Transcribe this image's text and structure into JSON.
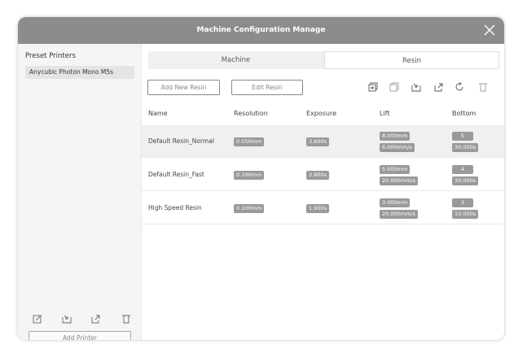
{
  "window": {
    "title": "Machine Configuration Manage"
  },
  "sidebar": {
    "title": "Preset Printers",
    "items": [
      {
        "label": "Anycubic Photon Mono M5s"
      }
    ],
    "icons": [
      "edit-icon",
      "import-icon",
      "export-icon",
      "delete-icon"
    ],
    "add_printer": "Add Printer"
  },
  "tabs": [
    {
      "label": "Machine",
      "active": false
    },
    {
      "label": "Resin",
      "active": true
    }
  ],
  "toolbar": {
    "add_new_resin": "Add New Resin",
    "edit_resin": "Edit Resin",
    "icons": [
      "add-copy-icon",
      "duplicate-icon",
      "import-icon",
      "export-icon",
      "reset-icon",
      "delete-icon"
    ]
  },
  "table": {
    "columns": [
      "Name",
      "Resolution",
      "Exposure",
      "Lift",
      "Bottom"
    ],
    "rows": [
      {
        "name": "Default Resin_Normal",
        "resolution": "0.050mm",
        "exposure": "3.600s",
        "lift_distance": "8.000mm",
        "lift_speed": "6.000mm/s",
        "bottom_layers": "5",
        "bottom_exposure": "30.000s",
        "selected": true
      },
      {
        "name": "Default Resin_Fast",
        "resolution": "0.100mm",
        "exposure": "3.800s",
        "lift_distance": "5.000mm",
        "lift_speed": "20.000mm/s",
        "bottom_layers": "4",
        "bottom_exposure": "30.000s",
        "selected": false
      },
      {
        "name": "High Speed Resin",
        "resolution": "0.100mm",
        "exposure": "1.900s",
        "lift_distance": "3.000mm",
        "lift_speed": "20.000mm/s",
        "bottom_layers": "3",
        "bottom_exposure": "10.000s",
        "selected": false
      }
    ]
  },
  "colors": {
    "titlebar": "#8c8c8c",
    "badge": "#9a9a9a",
    "selected_row": "#f0f0f0"
  }
}
